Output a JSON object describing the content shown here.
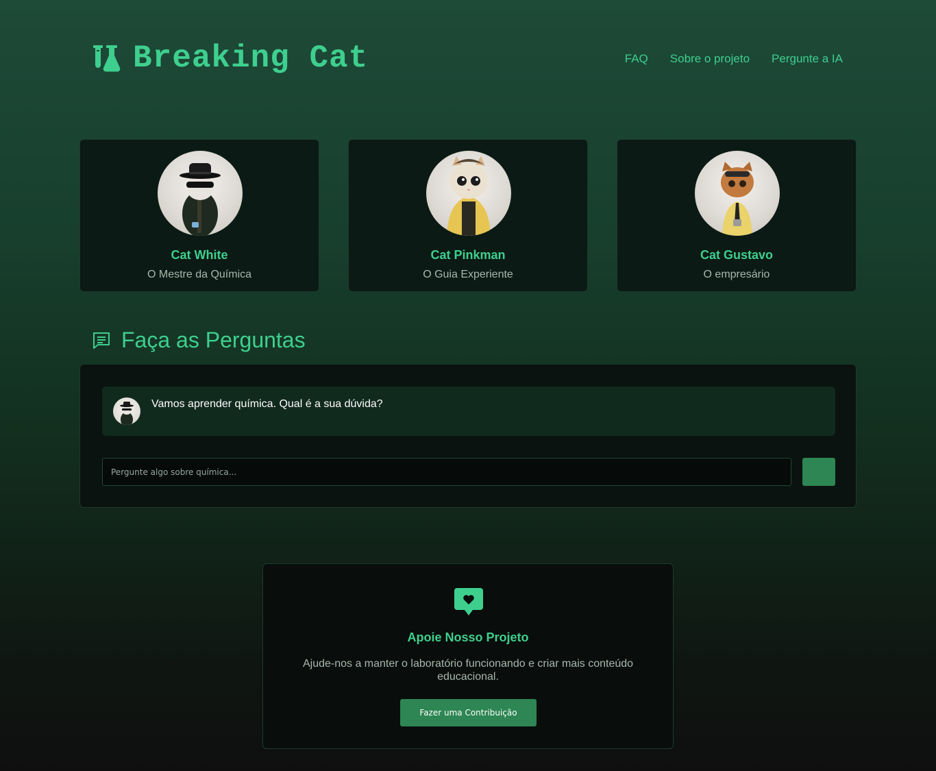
{
  "brand": {
    "title": "Breaking Cat",
    "icon": "flask-icon",
    "color": "#3ecf8e"
  },
  "nav": {
    "items": [
      "FAQ",
      "Sobre o projeto",
      "Pergunte a IA"
    ]
  },
  "characters": [
    {
      "name": "Cat White",
      "role": "O Mestre da Química",
      "outfit": "black hat, sunglasses, dark jacket"
    },
    {
      "name": "Cat Pinkman",
      "role": "O Guia Experiente",
      "outfit": "yellow jacket"
    },
    {
      "name": "Cat Gustavo",
      "role": "O empresário",
      "outfit": "yellow shirt, tie"
    }
  ],
  "chat": {
    "title": "Faça as Perguntas",
    "icon": "chat-icon",
    "messages": [
      {
        "text": "Vamos aprender química. Qual é a sua dúvida?"
      }
    ],
    "input_placeholder": "Pergunte algo sobre química...",
    "send_color": "#2d8653"
  },
  "support": {
    "icon": "heart-message-icon",
    "title": "Apoie Nosso Projeto",
    "text": "Ajude-nos a manter o laboratório funcionando e criar mais conteúdo educacional.",
    "button": "Fazer uma Contribuição"
  }
}
